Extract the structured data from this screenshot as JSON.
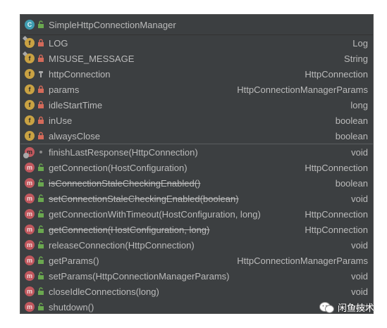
{
  "popup": {
    "title": "SimpleHttpConnectionManager",
    "fields": [
      {
        "name": "LOG",
        "type": "Log",
        "icon": "static-field-icon",
        "visibility": "private",
        "strike": false
      },
      {
        "name": "MISUSE_MESSAGE",
        "type": "String",
        "icon": "static-field-icon",
        "visibility": "private",
        "strike": false
      },
      {
        "name": "httpConnection",
        "type": "HttpConnection",
        "icon": "field-icon",
        "visibility": "protected",
        "strike": false
      },
      {
        "name": "params",
        "type": "HttpConnectionManagerParams",
        "icon": "field-icon",
        "visibility": "private",
        "strike": false
      },
      {
        "name": "idleStartTime",
        "type": "long",
        "icon": "field-icon",
        "visibility": "private",
        "strike": false
      },
      {
        "name": "inUse",
        "type": "boolean",
        "icon": "field-icon",
        "visibility": "private",
        "strike": false
      },
      {
        "name": "alwaysClose",
        "type": "boolean",
        "icon": "field-icon",
        "visibility": "private",
        "strike": false
      }
    ],
    "methods": [
      {
        "name": "finishLastResponse(HttpConnection)",
        "type": "void",
        "icon": "static-method-icon",
        "visibility": "package",
        "strike": false
      },
      {
        "name": "getConnection(HostConfiguration)",
        "type": "HttpConnection",
        "icon": "method-icon",
        "visibility": "public",
        "strike": false
      },
      {
        "name": "isConnectionStaleCheckingEnabled()",
        "type": "boolean",
        "icon": "method-icon",
        "visibility": "public",
        "strike": true
      },
      {
        "name": "setConnectionStaleCheckingEnabled(boolean)",
        "type": "void",
        "icon": "method-icon",
        "visibility": "public",
        "strike": true
      },
      {
        "name": "getConnectionWithTimeout(HostConfiguration, long)",
        "type": "HttpConnection",
        "icon": "method-icon",
        "visibility": "public",
        "strike": false
      },
      {
        "name": "getConnection(HostConfiguration, long)",
        "type": "HttpConnection",
        "icon": "method-icon",
        "visibility": "public",
        "strike": true
      },
      {
        "name": "releaseConnection(HttpConnection)",
        "type": "void",
        "icon": "method-icon",
        "visibility": "public",
        "strike": false
      },
      {
        "name": "getParams()",
        "type": "HttpConnectionManagerParams",
        "icon": "method-icon",
        "visibility": "public",
        "strike": false
      },
      {
        "name": "setParams(HttpConnectionManagerParams)",
        "type": "void",
        "icon": "method-icon",
        "visibility": "public",
        "strike": false
      },
      {
        "name": "closeIdleConnections(long)",
        "type": "void",
        "icon": "method-icon",
        "visibility": "public",
        "strike": false
      },
      {
        "name": "shutdown()",
        "type": "void",
        "icon": "method-icon",
        "visibility": "public",
        "strike": false
      }
    ]
  },
  "watermark": {
    "text": "闲鱼技术",
    "icon": "wechat-icon"
  },
  "colors": {
    "panel_bg": "#3c3f41",
    "text": "#bbbbbb",
    "class_icon": "#3f9db1",
    "field_icon": "#c9a243",
    "method_icon": "#c1585e",
    "private_lock": "#d46a5a",
    "public_lock": "#6aa84f"
  }
}
